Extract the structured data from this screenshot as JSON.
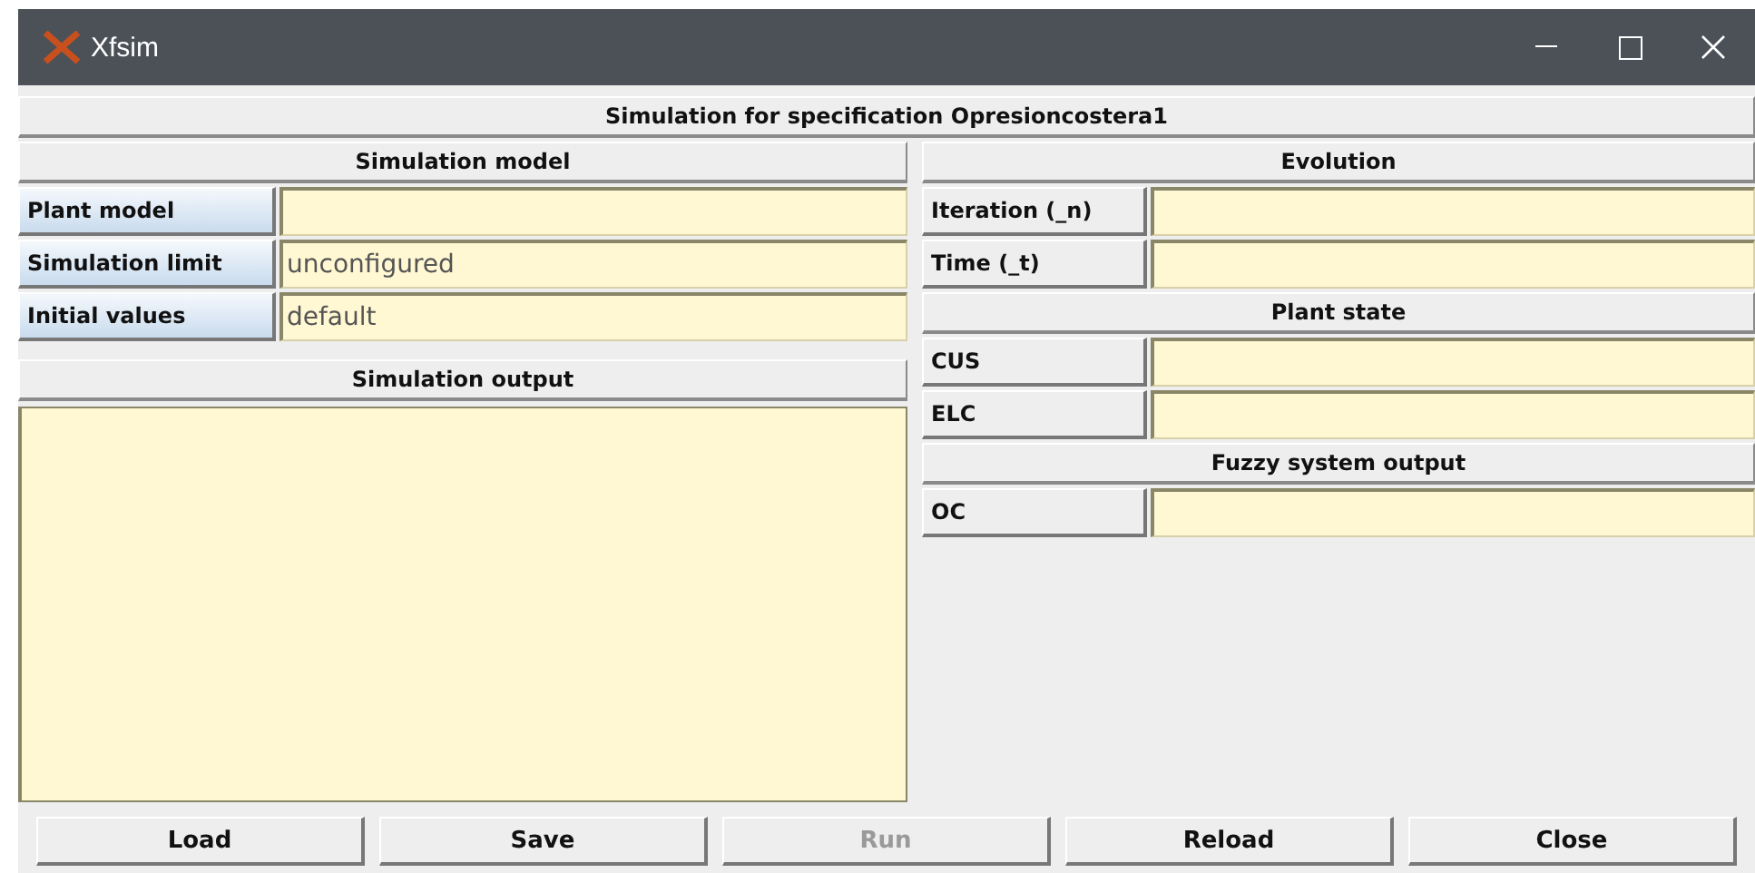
{
  "window": {
    "title": "Xfsim"
  },
  "header": "Simulation for specification Opresioncostera1",
  "simulation_model": {
    "title": "Simulation model",
    "rows": [
      {
        "label": "Plant model",
        "value": "",
        "highlighted": true
      },
      {
        "label": "Simulation limit",
        "value": "unconfigured",
        "highlighted": true
      },
      {
        "label": "Initial values",
        "value": "default",
        "highlighted": true
      }
    ]
  },
  "simulation_output": {
    "title": "Simulation output"
  },
  "sections": [
    {
      "title": "Evolution",
      "rows": [
        {
          "label": "Iteration (_n)",
          "value": ""
        },
        {
          "label": "Time (_t)",
          "value": ""
        }
      ]
    },
    {
      "title": "Plant state",
      "rows": [
        {
          "label": "CUS",
          "value": ""
        },
        {
          "label": "ELC",
          "value": ""
        }
      ]
    },
    {
      "title": "Fuzzy system output",
      "rows": [
        {
          "label": "OC",
          "value": ""
        }
      ]
    }
  ],
  "buttons": [
    {
      "label": "Load",
      "disabled": false
    },
    {
      "label": "Save",
      "disabled": false
    },
    {
      "label": "Run",
      "disabled": true
    },
    {
      "label": "Reload",
      "disabled": false
    },
    {
      "label": "Close",
      "disabled": false
    }
  ]
}
